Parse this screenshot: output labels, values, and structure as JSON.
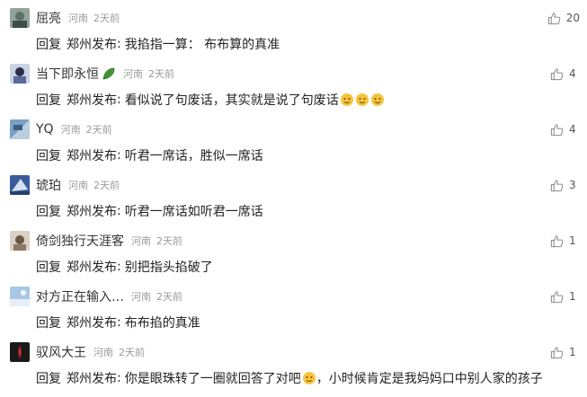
{
  "reply_label": "回复",
  "reply_target": "郑州发布",
  "colon": ":",
  "comments": [
    {
      "name": "屈亮",
      "location": "河南",
      "time": "2天前",
      "text": "我掐指一算： 布布算的真准",
      "likes": "20"
    },
    {
      "name": "当下即永恒",
      "location": "河南",
      "time": "2天前",
      "text": "看似说了句废话，其实就是说了句废话",
      "likes": "4"
    },
    {
      "name": "YQ",
      "location": "河南",
      "time": "2天前",
      "text": "听君一席话，胜似一席话",
      "likes": "4"
    },
    {
      "name": "琥珀",
      "location": "河南",
      "time": "2天前",
      "text": "听君一席话如听君一席话",
      "likes": "3"
    },
    {
      "name": "倚剑独行天涯客",
      "location": "河南",
      "time": "2天前",
      "text": "别把指头掐破了",
      "likes": "1"
    },
    {
      "name": "对方正在输入…",
      "location": "河南",
      "time": "2天前",
      "text": "布布掐的真准",
      "likes": "1"
    },
    {
      "name": "驭风大王",
      "location": "河南",
      "time": "2天前",
      "text": "你是眼珠转了一圈就回答了对吧",
      "text2": "，小时候肯定是我妈妈口中别人家的孩子",
      "likes": "1"
    }
  ],
  "icons": {
    "like": "thumbs-up-icon",
    "badge": "leaf-icon",
    "emoji": "emoji-icon"
  },
  "colors": {
    "meta": "#9a9a9a",
    "emoji": "#f6c33c",
    "badge": "#3f8f2f"
  }
}
